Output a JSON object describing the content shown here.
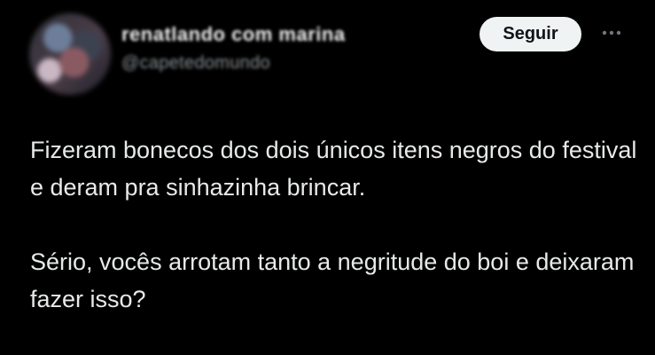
{
  "author": {
    "display_name": "renatlando com marina",
    "handle": "@capetedomundo"
  },
  "actions": {
    "follow_label": "Seguir",
    "more_icon": "ellipsis-icon"
  },
  "tweet": {
    "paragraphs": [
      "Fizeram bonecos dos dois únicos itens negros do festival e deram pra sinhazinha brincar.",
      "Sério, vocês arrotam tanto a negritude do boi e deixaram fazer isso?"
    ]
  },
  "colors": {
    "background": "#000000",
    "text": "#e7e9ea",
    "secondary_text": "#71767b",
    "button_bg": "#eff3f4",
    "button_text": "#0f1419"
  }
}
